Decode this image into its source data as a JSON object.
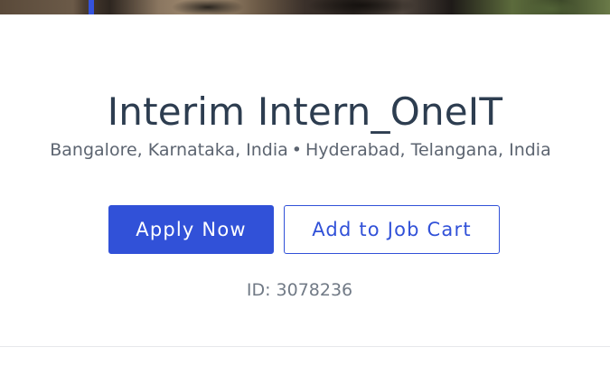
{
  "job": {
    "title": "Interim Intern_OneIT",
    "locations": [
      "Bangalore, Karnataka, India",
      "Hyderabad, Telangana, India"
    ],
    "separator": "•",
    "id_text": "ID: 3078236"
  },
  "actions": {
    "apply_label": "Apply Now",
    "cart_label": "Add to Job Cart"
  },
  "colors": {
    "primary": "#3151d8",
    "title_text": "#2d3d50",
    "muted_text": "#5c6470"
  }
}
